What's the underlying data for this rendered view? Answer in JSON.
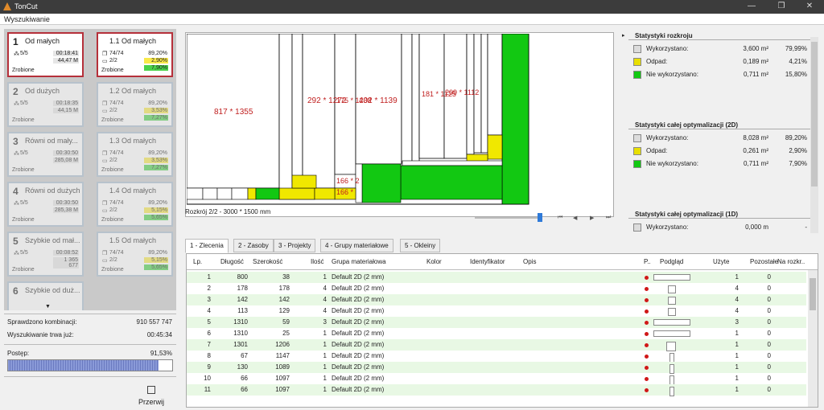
{
  "app": {
    "title": "TonCut",
    "menu": "Wyszukiwanie"
  },
  "left": {
    "col1": [
      {
        "n": "1",
        "name": "Od małych",
        "parts": "5/5",
        "time": "00:18:41",
        "len": "44,47 M",
        "status": "Zrobione",
        "active": true
      },
      {
        "n": "2",
        "name": "Od dużych",
        "parts": "5/5",
        "time": "00:18:35",
        "len": "44,15 M",
        "status": "Zrobione",
        "active": false
      },
      {
        "n": "3",
        "name": "Równi od mały...",
        "parts": "5/5",
        "time": "00:30:50",
        "len": "285,08 M",
        "status": "Zrobione",
        "active": false
      },
      {
        "n": "4",
        "name": "Równi od dużych",
        "parts": "5/5",
        "time": "00:30:50",
        "len": "285,38 M",
        "status": "Zrobione",
        "active": false
      },
      {
        "n": "5",
        "name": "Szybkie od mał...",
        "parts": "5/5",
        "time": "00:08:52",
        "len": "1 365 677",
        "status": "Zrobione",
        "active": false
      },
      {
        "n": "6",
        "name": "Szybkie od duż...",
        "parts": "",
        "time": "",
        "len": "",
        "status": "",
        "active": false
      }
    ],
    "col2": [
      {
        "n": "1.1",
        "name": "Od małych",
        "a": "74/74",
        "b": "2/2",
        "p1": "89,20%",
        "p2": "2,90%",
        "p3": "7,90%",
        "status": "Zrobione",
        "active": true
      },
      {
        "n": "1.2",
        "name": "Od małych",
        "a": "74/74",
        "b": "2/2",
        "p1": "89,20%",
        "p2": "3,53%",
        "p3": "7,27%",
        "status": "Zrobione",
        "active": false
      },
      {
        "n": "1.3",
        "name": "Od małych",
        "a": "74/74",
        "b": "2/2",
        "p1": "89,20%",
        "p2": "3,53%",
        "p3": "7,27%",
        "status": "Zrobione",
        "active": false
      },
      {
        "n": "1.4",
        "name": "Od małych",
        "a": "74/74",
        "b": "2/2",
        "p1": "89,20%",
        "p2": "5,15%",
        "p3": "5,65%",
        "status": "Zrobione",
        "active": false
      },
      {
        "n": "1.5",
        "name": "Od małych",
        "a": "74/74",
        "b": "2/2",
        "p1": "89,20%",
        "p2": "5,15%",
        "p3": "5,65%",
        "status": "Zrobione",
        "active": false
      }
    ],
    "checked_label": "Sprawdzono kombinacji:",
    "checked_value": "910 557 747",
    "time_label": "Wyszukiwanie trwa już:",
    "time_value": "00:45:34",
    "progress_label": "Postęp:",
    "progress_value": "91,53%",
    "progress_fraction": 0.9153,
    "stop_label": "Przerwij"
  },
  "viewer": {
    "caption": "Rozkrój 2/2 - 3000 * 1500 mm"
  },
  "diagram_labels": {
    "big": "817 * 1355",
    "p2": "292 * 1272",
    "p3": "175 * 1238",
    "p4": "402 * 1139",
    "p5": "181 * 1125",
    "p6": "209 * 1112",
    "p7": "166 * 2",
    "p8": "166 *"
  },
  "stats": {
    "title1": "Statystyki rozkroju",
    "rows1": [
      {
        "label": "Wykorzystano:",
        "v1": "3,600 m²",
        "v2": "79,99%",
        "color": "#dcdcdc"
      },
      {
        "label": "Odpad:",
        "v1": "0,189 m²",
        "v2": "4,21%",
        "color": "#e8df00"
      },
      {
        "label": "Nie wykorzystano:",
        "v1": "0,711 m²",
        "v2": "15,80%",
        "color": "#12c812"
      }
    ],
    "title2": "Statystyki całej optymalizacji (2D)",
    "rows2": [
      {
        "label": "Wykorzystano:",
        "v1": "8,028 m²",
        "v2": "89,20%",
        "color": "#dcdcdc"
      },
      {
        "label": "Odpad:",
        "v1": "0,261 m²",
        "v2": "2,90%",
        "color": "#e8df00"
      },
      {
        "label": "Nie wykorzystano:",
        "v1": "0,711 m²",
        "v2": "7,90%",
        "color": "#12c812"
      }
    ],
    "title3": "Statystyki całej optymalizacji (1D)",
    "rows3": [
      {
        "label": "Wykorzystano:",
        "v1": "0,000 m",
        "v2": "-",
        "color": "#dcdcdc"
      }
    ]
  },
  "tabs": [
    "1 - Zlecenia",
    "2 - Zasoby",
    "3 - Projekty",
    "4 - Grupy materiałowe",
    "5 - Okleiny"
  ],
  "table": {
    "headers": [
      "Lp.",
      "Długość",
      "Szerokość",
      "Ilość",
      "Grupa materiałowa",
      "Kolor",
      "Identyfikator",
      "Opis",
      "P..",
      "Podgląd",
      "Użyte",
      "Pozostałe",
      "Na rozkr.."
    ],
    "rows": [
      [
        "1",
        "800",
        "38",
        "1",
        "Default 2D (2 mm)",
        "",
        "",
        "",
        "",
        "",
        "1",
        "0",
        ""
      ],
      [
        "2",
        "178",
        "178",
        "4",
        "Default 2D (2 mm)",
        "",
        "",
        "",
        "",
        "",
        "4",
        "0",
        ""
      ],
      [
        "3",
        "142",
        "142",
        "4",
        "Default 2D (2 mm)",
        "",
        "",
        "",
        "",
        "",
        "4",
        "0",
        ""
      ],
      [
        "4",
        "113",
        "129",
        "4",
        "Default 2D (2 mm)",
        "",
        "",
        "",
        "",
        "",
        "4",
        "0",
        ""
      ],
      [
        "5",
        "1310",
        "59",
        "3",
        "Default 2D (2 mm)",
        "",
        "",
        "",
        "",
        "",
        "3",
        "0",
        ""
      ],
      [
        "6",
        "1310",
        "25",
        "1",
        "Default 2D (2 mm)",
        "",
        "",
        "",
        "",
        "",
        "1",
        "0",
        ""
      ],
      [
        "7",
        "1301",
        "1206",
        "1",
        "Default 2D (2 mm)",
        "",
        "",
        "",
        "",
        "",
        "1",
        "0",
        ""
      ],
      [
        "8",
        "67",
        "1147",
        "1",
        "Default 2D (2 mm)",
        "",
        "",
        "",
        "",
        "",
        "1",
        "0",
        ""
      ],
      [
        "9",
        "130",
        "1089",
        "1",
        "Default 2D (2 mm)",
        "",
        "",
        "",
        "",
        "",
        "1",
        "0",
        ""
      ],
      [
        "10",
        "66",
        "1097",
        "1",
        "Default 2D (2 mm)",
        "",
        "",
        "",
        "",
        "",
        "1",
        "0",
        ""
      ],
      [
        "11",
        "66",
        "1097",
        "1",
        "Default 2D (2 mm)",
        "",
        "",
        "",
        "",
        "",
        "1",
        "0",
        ""
      ]
    ]
  }
}
